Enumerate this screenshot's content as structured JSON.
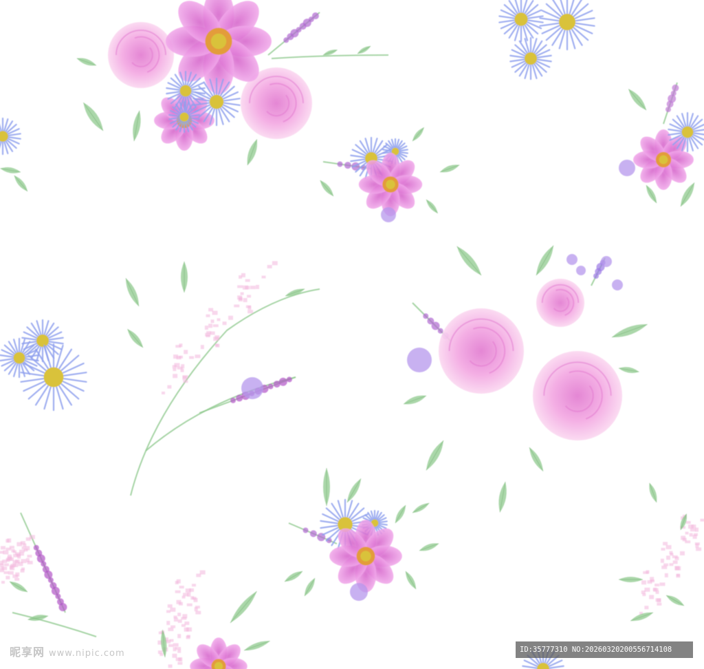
{
  "image": {
    "description_tag": "watercolor-floral-seamless-pattern",
    "background_color": "#ffffff"
  },
  "palette": {
    "rose_pink": "#f3a6e2",
    "rose_dark": "#e27ad0",
    "cosmos_magenta": "#e675d9",
    "daisy_periwinkle": "#8fa0ee",
    "flower_center_yellow": "#d9c23a",
    "leaf_green": "#8fc98d",
    "lavender": "#b06ad1",
    "blossom_pink": "#f2b6dc"
  },
  "watermark": {
    "brand": "昵享网",
    "site": "www.nipic.com",
    "id_text": "ID:35777310 NO:20260320200556714108"
  }
}
